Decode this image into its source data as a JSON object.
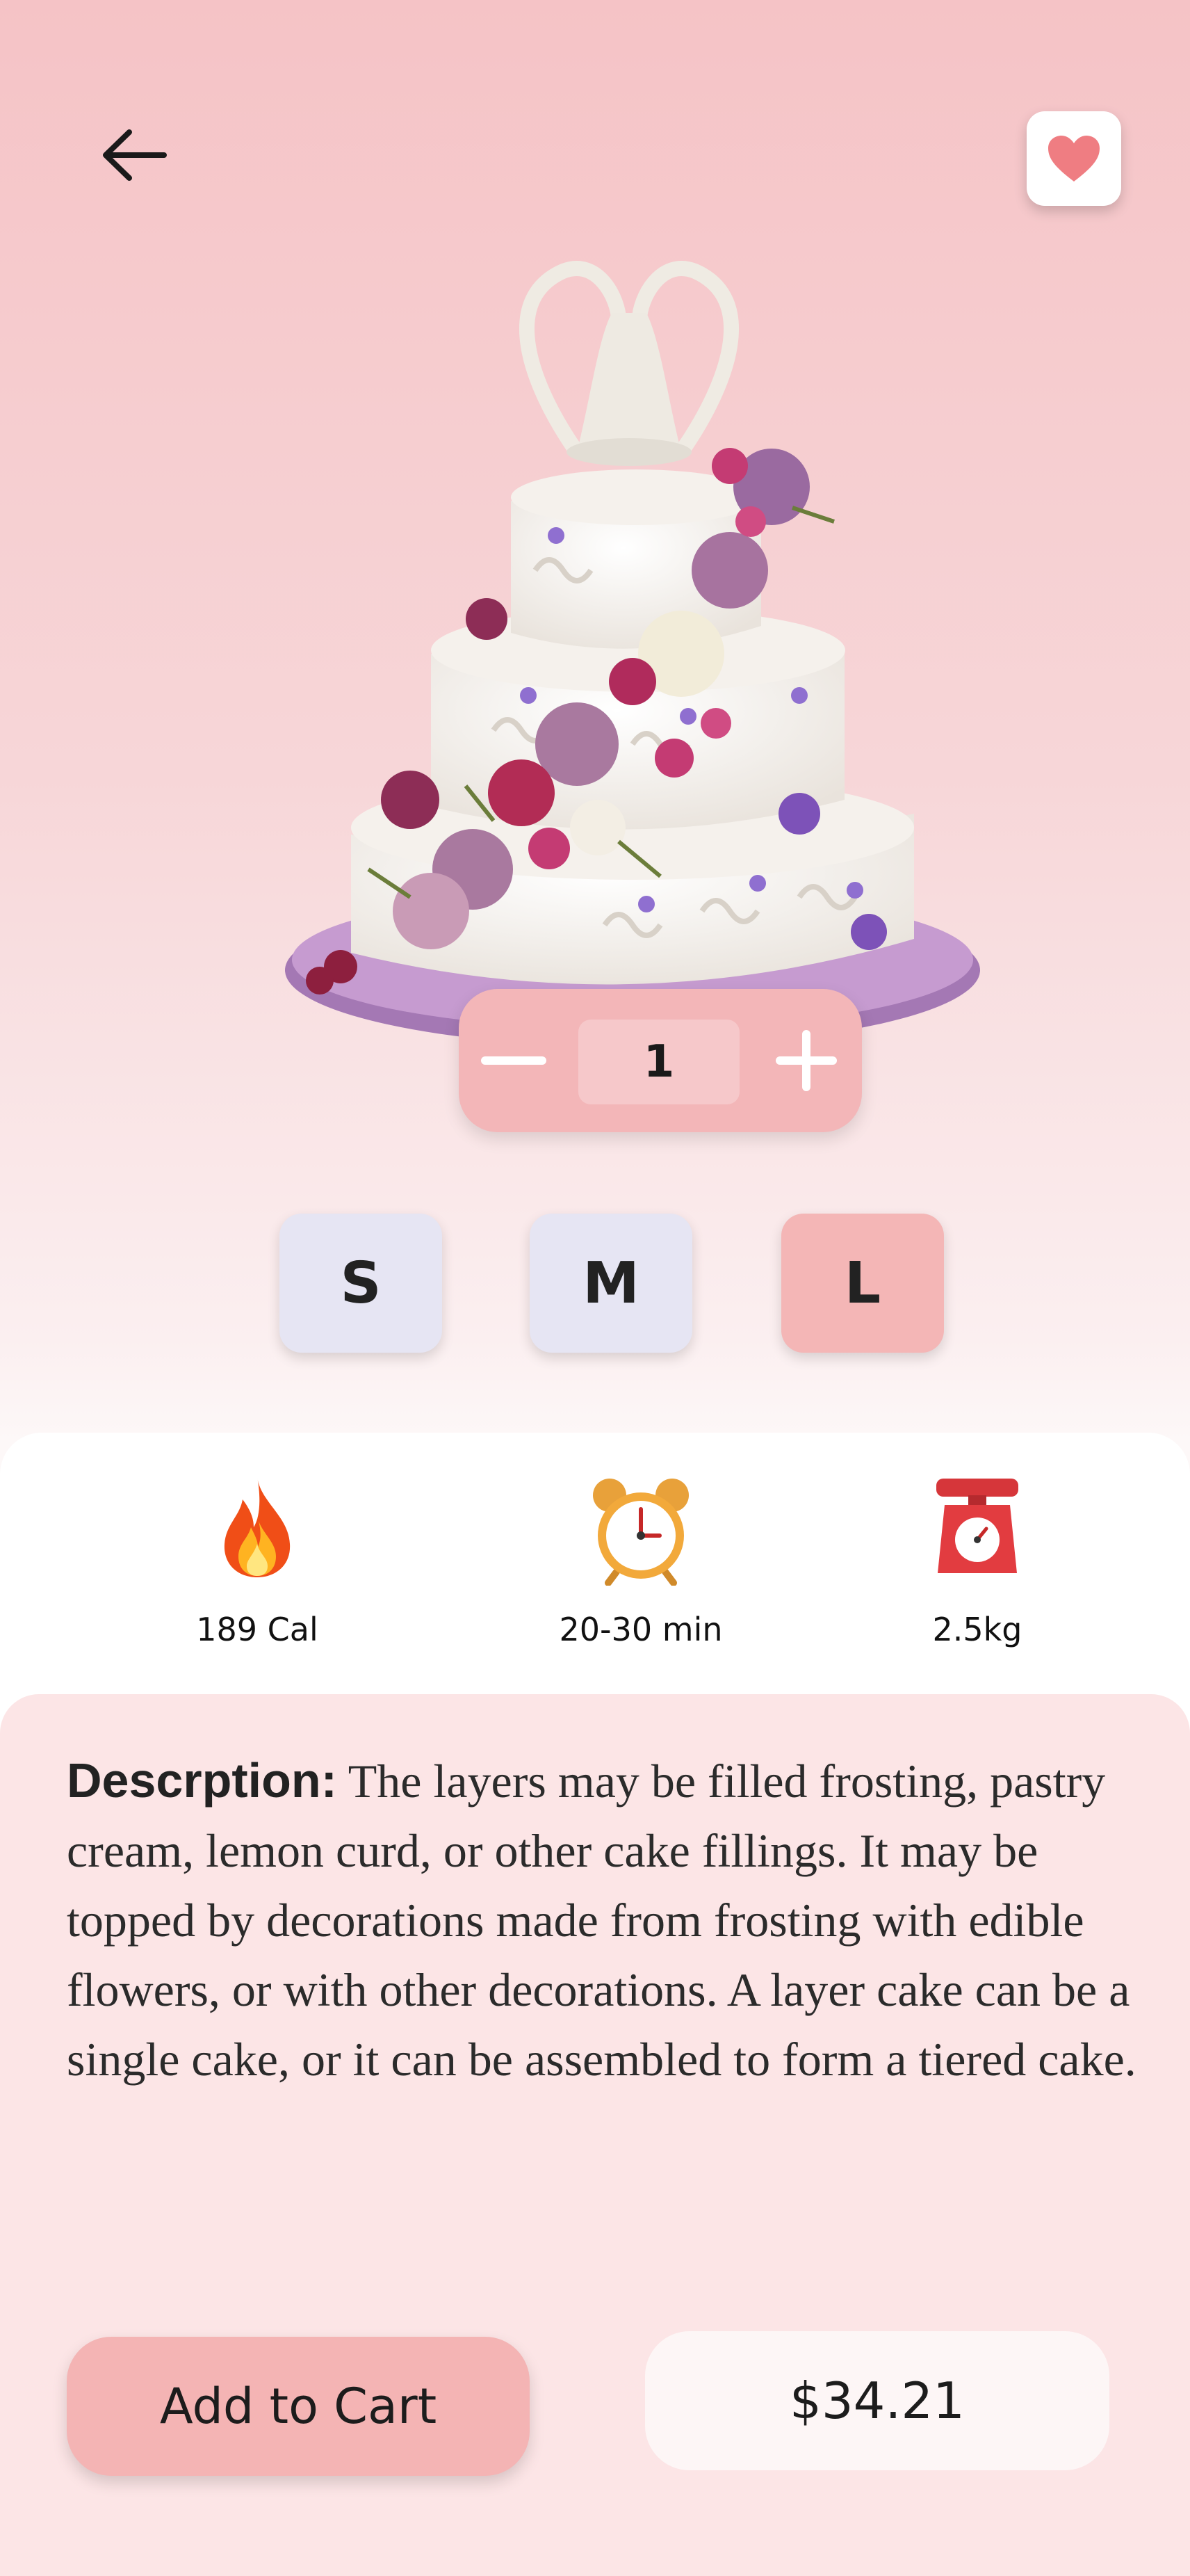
{
  "header": {
    "back_icon": "arrow-left-icon",
    "favorite_icon": "heart-icon"
  },
  "product": {
    "image_icon": "tiered-wedding-cake-image",
    "quantity": "1",
    "sizes": [
      "S",
      "M",
      "L"
    ],
    "selected_size": "L"
  },
  "stats": [
    {
      "icon": "fire-icon",
      "label": "189 Cal"
    },
    {
      "icon": "alarm-clock-icon",
      "label": "20-30 min"
    },
    {
      "icon": "kitchen-scale-icon",
      "label": "2.5kg"
    }
  ],
  "description": {
    "title": "Descrption:",
    "text": "The layers may be filled frosting, pastry cream, lemon curd, or other cake fillings. It may be topped by decorations made from frosting with edible flowers, or with other decorations. A layer cake can be a single cake, or it can be assembled to form a tiered cake."
  },
  "footer": {
    "add_to_cart_label": "Add to Cart",
    "price": "$34.21"
  },
  "colors": {
    "accent_pink": "#f4b6b6",
    "size_bg": "#e6e5f3",
    "heart": "#ef7d82"
  }
}
